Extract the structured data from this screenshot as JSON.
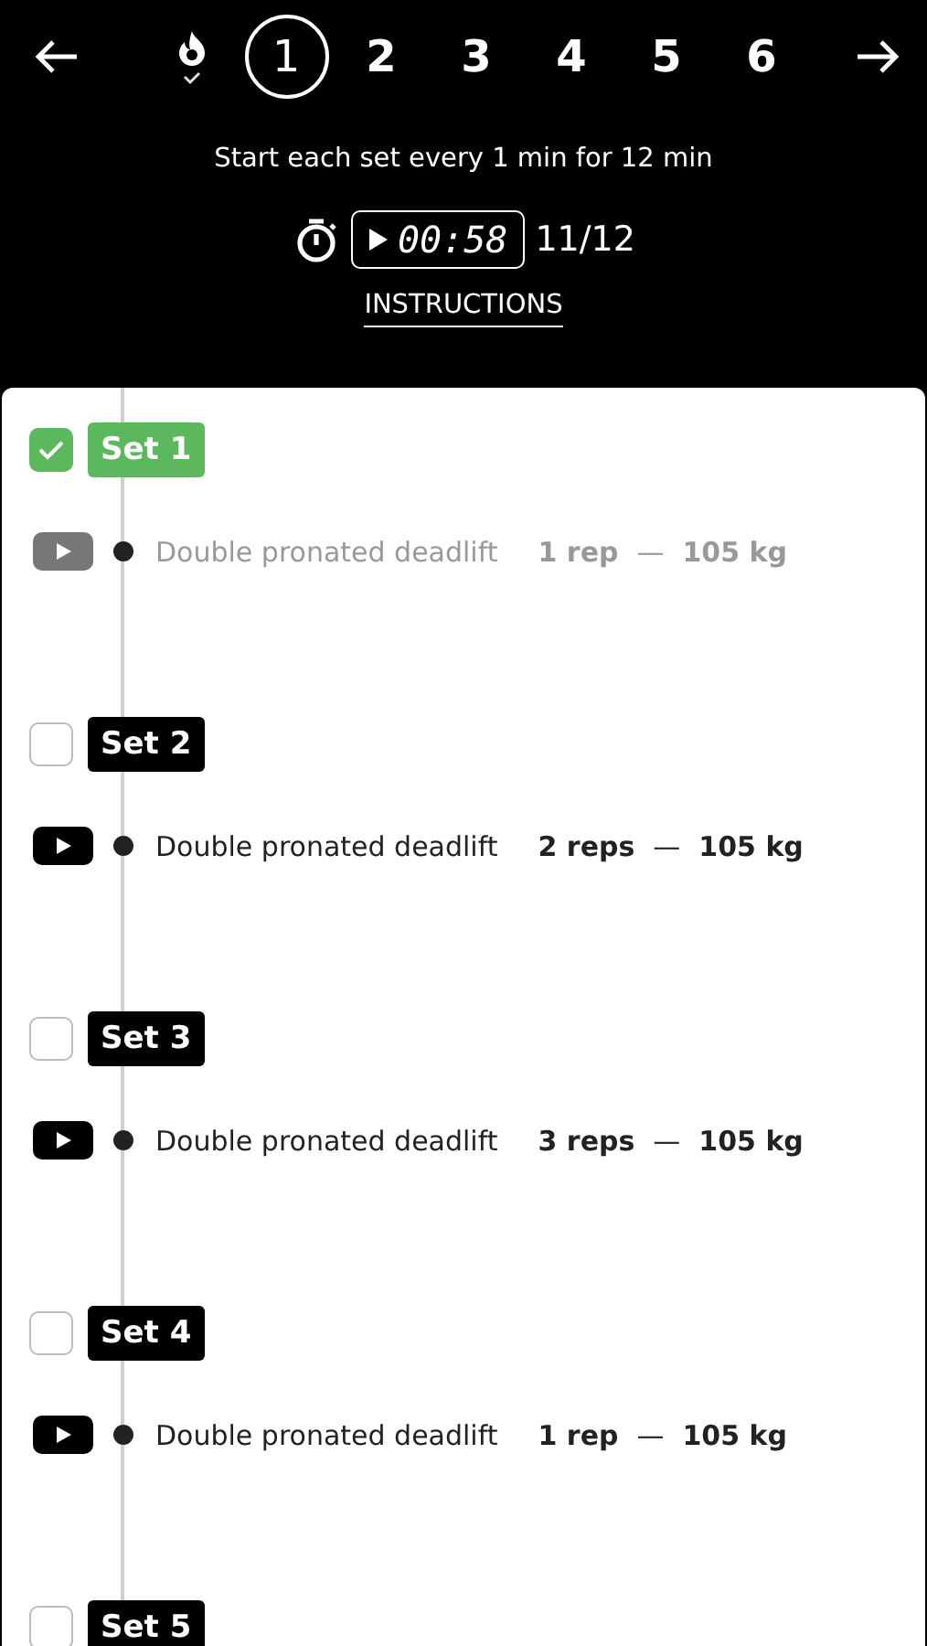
{
  "nav": {
    "rounds": [
      {
        "kind": "warmup",
        "done": true,
        "selected": false
      },
      {
        "kind": "number",
        "label": "1",
        "selected": true
      },
      {
        "kind": "number",
        "label": "2",
        "selected": false
      },
      {
        "kind": "number",
        "label": "3",
        "selected": false
      },
      {
        "kind": "number",
        "label": "4",
        "selected": false
      },
      {
        "kind": "number",
        "label": "5",
        "selected": false
      },
      {
        "kind": "number",
        "label": "6",
        "selected": false
      }
    ]
  },
  "subtitle": "Start each set every 1 min for 12 min",
  "timer": {
    "time": "00:58",
    "count": "11/12"
  },
  "instructions": "INSTRUCTIONS",
  "sets": [
    {
      "label": "Set 1",
      "checked": true,
      "exercise": {
        "name": "Double pronated deadlift",
        "reps": "1 rep",
        "separator": "—",
        "weight": "105 kg"
      }
    },
    {
      "label": "Set 2",
      "checked": false,
      "exercise": {
        "name": "Double pronated deadlift",
        "reps": "2 reps",
        "separator": "—",
        "weight": "105 kg"
      }
    },
    {
      "label": "Set 3",
      "checked": false,
      "exercise": {
        "name": "Double pronated deadlift",
        "reps": "3 reps",
        "separator": "—",
        "weight": "105 kg"
      }
    },
    {
      "label": "Set 4",
      "checked": false,
      "exercise": {
        "name": "Double pronated deadlift",
        "reps": "1 rep",
        "separator": "—",
        "weight": "105 kg"
      }
    },
    {
      "label": "Set 5",
      "checked": false
    }
  ]
}
